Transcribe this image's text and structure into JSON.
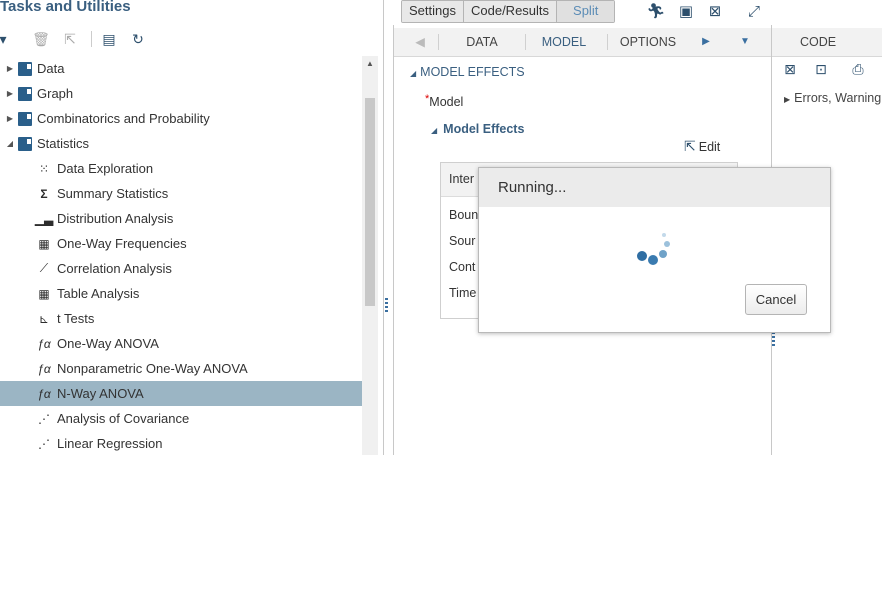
{
  "left_panel": {
    "title": "Tasks and Utilities",
    "tree": [
      {
        "label": "Data",
        "icon": "folder-icon",
        "expanded": false
      },
      {
        "label": "Graph",
        "icon": "folder-icon",
        "expanded": false
      },
      {
        "label": "Combinatorics and Probability",
        "icon": "folder-icon",
        "expanded": false
      },
      {
        "label": "Statistics",
        "icon": "folder-icon",
        "expanded": true
      },
      {
        "label": "Data Exploration",
        "icon": "data-exploration-icon"
      },
      {
        "label": "Summary Statistics",
        "icon": "sigma-icon"
      },
      {
        "label": "Distribution Analysis",
        "icon": "histogram-icon"
      },
      {
        "label": "One-Way Frequencies",
        "icon": "table-icon"
      },
      {
        "label": "Correlation Analysis",
        "icon": "line-chart-icon"
      },
      {
        "label": "Table Analysis",
        "icon": "table-icon"
      },
      {
        "label": "t Tests",
        "icon": "ttest-icon"
      },
      {
        "label": "One-Way ANOVA",
        "icon": "anova-icon"
      },
      {
        "label": "Nonparametric One-Way ANOVA",
        "icon": "anova-icon"
      },
      {
        "label": "N-Way ANOVA",
        "icon": "anova-icon",
        "selected": true
      },
      {
        "label": "Analysis of Covariance",
        "icon": "scatter-icon"
      },
      {
        "label": "Linear Regression",
        "icon": "scatter-icon"
      }
    ]
  },
  "topbar": {
    "settings": "Settings",
    "code_results": "Code/Results",
    "split": "Split"
  },
  "middle": {
    "tabs": [
      "DATA",
      "MODEL",
      "OPTIONS"
    ],
    "active_tab": "MODEL",
    "section_heading": "MODEL EFFECTS",
    "required_mark": "*",
    "model_label": "Model",
    "model_effects_heading": "Model Effects",
    "edit_label": "Edit",
    "table_header": "Inter",
    "table_rows": [
      "Boun",
      "Sour",
      "Cont",
      "Time"
    ]
  },
  "right": {
    "tab": "CODE",
    "errors_label": "Errors, Warning"
  },
  "modal": {
    "title": "Running...",
    "cancel_label": "Cancel"
  },
  "colors": {
    "accent": "#3a5f80",
    "selection": "#9bb5c4",
    "spinner": "#3a7bb0"
  }
}
